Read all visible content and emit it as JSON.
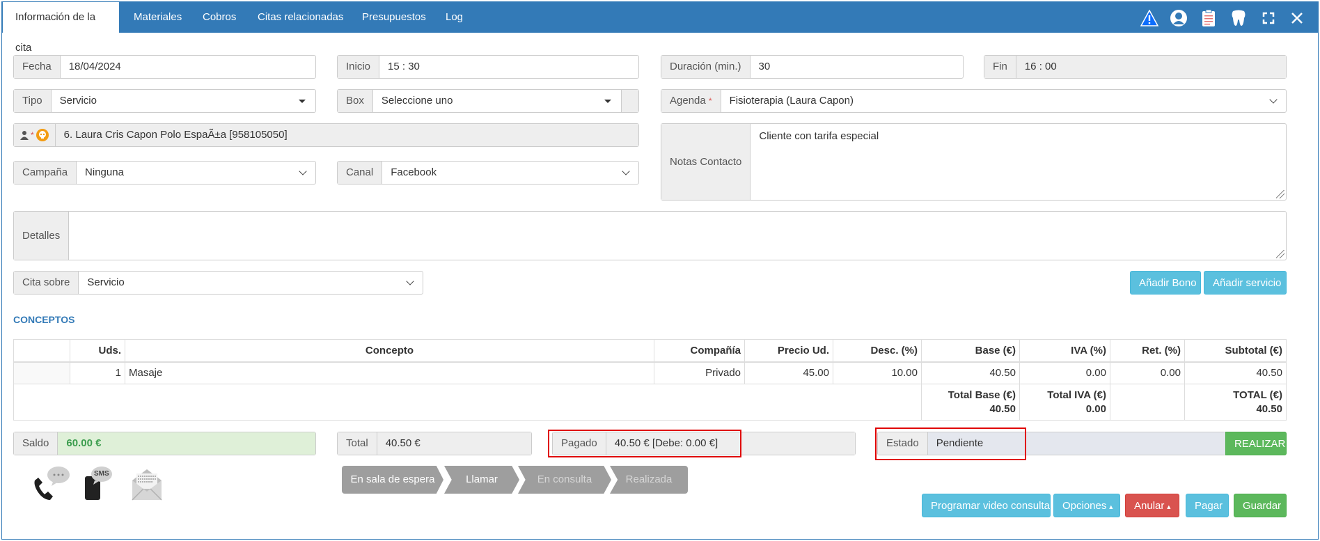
{
  "tabs": [
    "Información de la cita",
    "Materiales",
    "Cobros",
    "Citas relacionadas",
    "Presupuestos",
    "Log"
  ],
  "header_icons": [
    "warning-icon",
    "user-circle-icon",
    "clipboard-icon",
    "tooth-icon",
    "expand-icon",
    "close-icon"
  ],
  "form": {
    "fecha_label": "Fecha",
    "fecha_value": "18/04/2024",
    "inicio_label": "Inicio",
    "inicio_value": "15 : 30",
    "duracion_label": "Duración (min.)",
    "duracion_value": "30",
    "fin_label": "Fin",
    "fin_value": "16 : 00",
    "tipo_label": "Tipo",
    "tipo_value": "Servicio",
    "box_label": "Box",
    "box_value": "Seleccione uno",
    "agenda_label": "Agenda",
    "agenda_required": "*",
    "agenda_value": "Fisioterapia (Laura Capon)",
    "patient_required": "*",
    "patient_value": "6. Laura Cris Capon Polo EspaÃ±a [958105050]",
    "notas_label": "Notas Contacto",
    "notas_value": "Cliente con tarifa especial",
    "campana_label": "Campaña",
    "campana_value": "Ninguna",
    "canal_label": "Canal",
    "canal_value": "Facebook",
    "detalles_label": "Detalles",
    "detalles_value": "",
    "cita_sobre_label": "Cita sobre",
    "cita_sobre_value": "Servicio"
  },
  "buttons": {
    "anadir_bono": "Añadir Bono",
    "anadir_servicio": "Añadir servicio",
    "realizar": "REALIZAR",
    "programar_video": "Programar video consulta",
    "opciones": "Opciones",
    "anular": "Anular",
    "pagar": "Pagar",
    "guardar": "Guardar"
  },
  "conceptos": {
    "title": "CONCEPTOS",
    "headers": [
      "",
      "Uds.",
      "Concepto",
      "Compañía",
      "Precio Ud.",
      "Desc. (%)",
      "Base (€)",
      "IVA (%)",
      "Ret. (%)",
      "Subtotal (€)"
    ],
    "rows": [
      [
        "",
        "1",
        "Masaje",
        "Privado",
        "45.00",
        "10.00",
        "40.50",
        "0.00",
        "0.00",
        "40.50"
      ]
    ],
    "totals": {
      "base_label": "Total Base (€)",
      "base_value": "40.50",
      "iva_label": "Total IVA (€)",
      "iva_value": "0.00",
      "total_label": "TOTAL (€)",
      "total_value": "40.50"
    }
  },
  "summary": {
    "saldo_label": "Saldo",
    "saldo_value": "60.00 €",
    "total_label": "Total",
    "total_value": "40.50 €",
    "pagado_label": "Pagado",
    "pagado_value": "40.50 € [Debe: 0.00 €]",
    "estado_label": "Estado",
    "estado_value": "Pendiente"
  },
  "contact_icons": [
    "phone-icon",
    "sms-icon",
    "email-icon"
  ],
  "sms_text": "SMS",
  "steps": [
    "En sala de espera",
    "Llamar",
    "En consulta",
    "Realizada"
  ],
  "colors": {
    "primary": "#337ab7",
    "info": "#5bc0de",
    "danger": "#d9534f",
    "success": "#5cb85c",
    "saldo_bg": "#dff0d8",
    "saldo_text": "#3c9d4e",
    "highlight": "#e00000"
  }
}
